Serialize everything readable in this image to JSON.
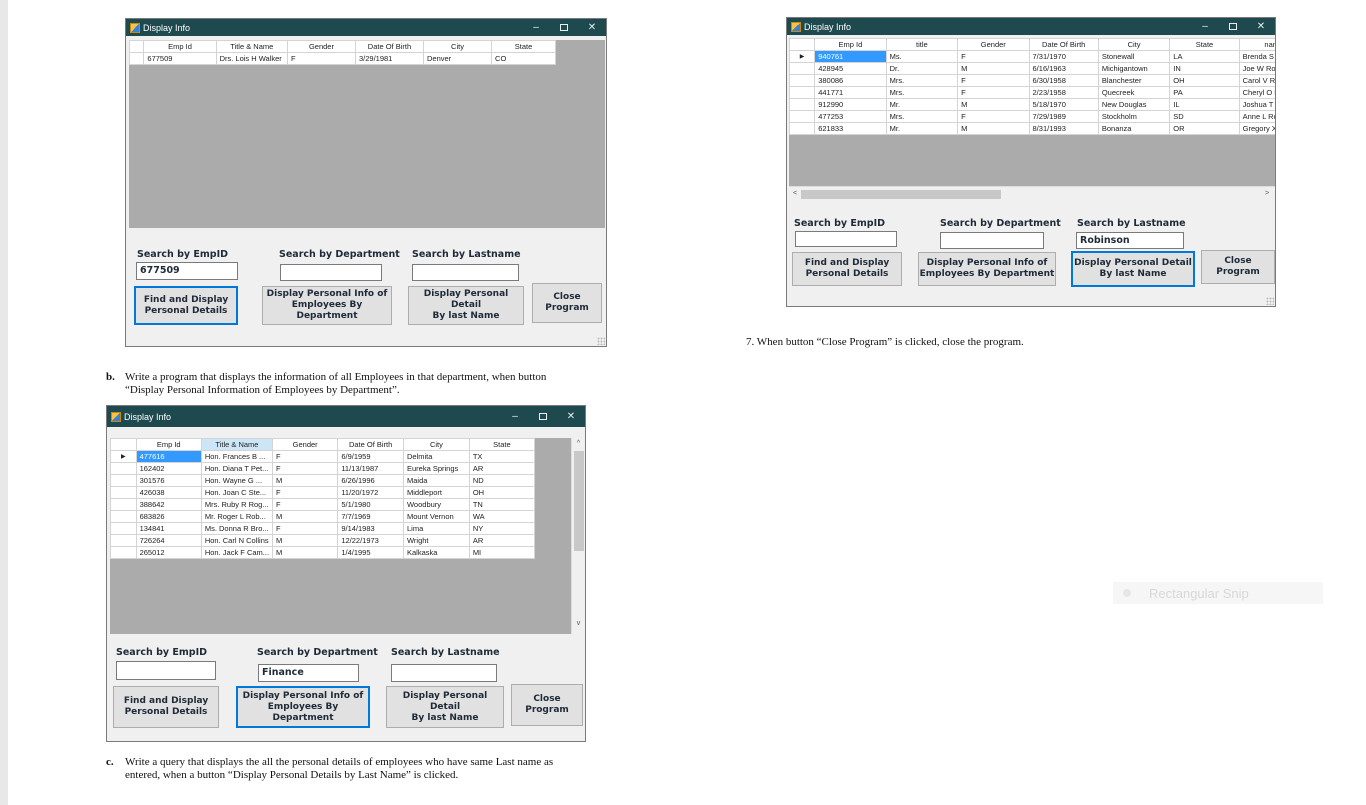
{
  "window_title": "Display Info",
  "labels": {
    "search_empid": "Search by EmpID",
    "search_dept": "Search by Department",
    "search_lastname": "Search by Lastname"
  },
  "buttons": {
    "find_line1": "Find and Display",
    "find_line2": "Personal Details",
    "dept_line1": "Display Personal Info of",
    "dept_line2": "Employees By Department",
    "lastname_line1": "Display Personal Detail",
    "lastname_line2": "By last Name",
    "close_line1": "Close",
    "close_line2": "Program"
  },
  "win1": {
    "columns": [
      "Emp Id",
      "Title & Name",
      "Gender",
      "Date Of Birth",
      "City",
      "State"
    ],
    "rows": [
      [
        "677509",
        "Drs. Lois H Walker",
        "F",
        "3/29/1981",
        "Denver",
        "CO"
      ]
    ],
    "empid_value": "677509",
    "dept_value": "",
    "lastname_value": ""
  },
  "win2": {
    "columns": [
      "Emp Id",
      "title",
      "Gender",
      "Date Of Birth",
      "City",
      "State",
      "name"
    ],
    "rows": [
      [
        "940761",
        "Ms.",
        "F",
        "7/31/1970",
        "Stonewall",
        "LA",
        "Brenda S Robir"
      ],
      [
        "428945",
        "Dr.",
        "M",
        "6/16/1963",
        "Michigantown",
        "IN",
        "Joe W Robinso"
      ],
      [
        "380086",
        "Mrs.",
        "F",
        "6/30/1958",
        "Blanchester",
        "OH",
        "Carol V Robinso"
      ],
      [
        "441771",
        "Mrs.",
        "F",
        "2/23/1958",
        "Quecreek",
        "PA",
        "Cheryl O Robins"
      ],
      [
        "912990",
        "Mr.",
        "M",
        "5/18/1970",
        "New Douglas",
        "IL",
        "Joshua T Robir"
      ],
      [
        "477253",
        "Mrs.",
        "F",
        "7/29/1989",
        "Stockholm",
        "SD",
        "Anne L Robinsc"
      ],
      [
        "621833",
        "Mr.",
        "M",
        "8/31/1993",
        "Bonanza",
        "OR",
        "Gregory X Robi"
      ]
    ],
    "empid_value": "",
    "dept_value": "",
    "lastname_value": "Robinson"
  },
  "win3": {
    "columns": [
      "Emp Id",
      "Title & Name",
      "Gender",
      "Date Of Birth",
      "City",
      "State"
    ],
    "rows": [
      [
        "477616",
        "Hon. Frances B ...",
        "F",
        "6/9/1959",
        "Delmita",
        "TX"
      ],
      [
        "162402",
        "Hon. Diana T Pet...",
        "F",
        "11/13/1987",
        "Eureka Springs",
        "AR"
      ],
      [
        "301576",
        "Hon. Wayne G ...",
        "M",
        "6/26/1996",
        "Maida",
        "ND"
      ],
      [
        "426038",
        "Hon. Joan C Ste...",
        "F",
        "11/20/1972",
        "Middleport",
        "OH"
      ],
      [
        "388642",
        "Mrs. Ruby R Rog...",
        "F",
        "5/1/1980",
        "Woodbury",
        "TN"
      ],
      [
        "683826",
        "Mr. Roger L Rob...",
        "M",
        "7/7/1969",
        "Mount Vernon",
        "WA"
      ],
      [
        "134841",
        "Ms. Donna R Bro...",
        "F",
        "9/14/1983",
        "Lima",
        "NY"
      ],
      [
        "726264",
        "Hon. Carl N Collins",
        "M",
        "12/22/1973",
        "Wright",
        "AR"
      ],
      [
        "265012",
        "Hon. Jack F Cam...",
        "M",
        "1/4/1995",
        "Kalkaska",
        "MI"
      ]
    ],
    "empid_value": "",
    "dept_value": "Finance",
    "lastname_value": ""
  },
  "doc": {
    "b_label": "b.",
    "b_line1": "Write a program that displays the information of all Employees in that department, when button",
    "b_line2": "“Display Personal Information of Employees by Department”.",
    "c_label": "c.",
    "c_line1": "Write a query that displays the all the personal details of employees who have same Last name as",
    "c_line2": "entered, when a button “Display Personal Details by Last Name” is clicked.",
    "item7": "7.   When button “Close Program” is clicked, close the program."
  },
  "snip_overlay": "Rectangular Snip",
  "colors": {
    "titlebar": "#1e4a4f",
    "selection": "#3399ff",
    "focus_border": "#0078d7",
    "grid_bg": "#ababab"
  }
}
